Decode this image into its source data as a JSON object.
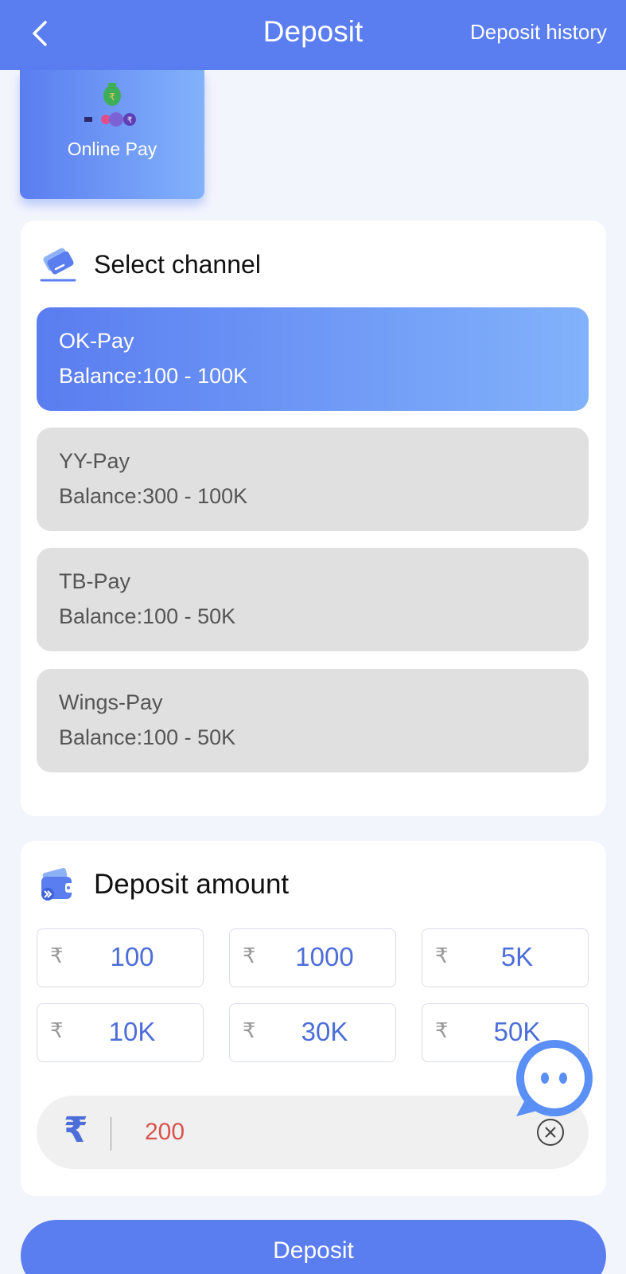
{
  "header": {
    "title": "Deposit",
    "history_label": "Deposit history",
    "back_icon": "chevron-left-icon"
  },
  "payment_type": {
    "label": "Online Pay",
    "selected": true
  },
  "channel_section": {
    "title": "Select channel",
    "icon": "card-icon",
    "channels": [
      {
        "name": "OK-Pay",
        "balance": "Balance:100 - 100K",
        "selected": true
      },
      {
        "name": "YY-Pay",
        "balance": "Balance:300 - 100K",
        "selected": false
      },
      {
        "name": "TB-Pay",
        "balance": "Balance:100 - 50K",
        "selected": false
      },
      {
        "name": "Wings-Pay",
        "balance": "Balance:100 - 50K",
        "selected": false
      }
    ]
  },
  "amount_section": {
    "title": "Deposit amount",
    "icon": "wallet-icon",
    "currency_symbol": "₹",
    "presets": [
      "100",
      "1000",
      "5K",
      "10K",
      "30K",
      "50K"
    ],
    "input_value": "200",
    "clear_icon": "clear-circle-icon"
  },
  "deposit_button": {
    "label": "Deposit"
  },
  "colors": {
    "primary": "#5a7df0",
    "gradient_end": "#82b2fb",
    "amount_text": "#4d6ed8",
    "input_text": "#d9534f"
  }
}
